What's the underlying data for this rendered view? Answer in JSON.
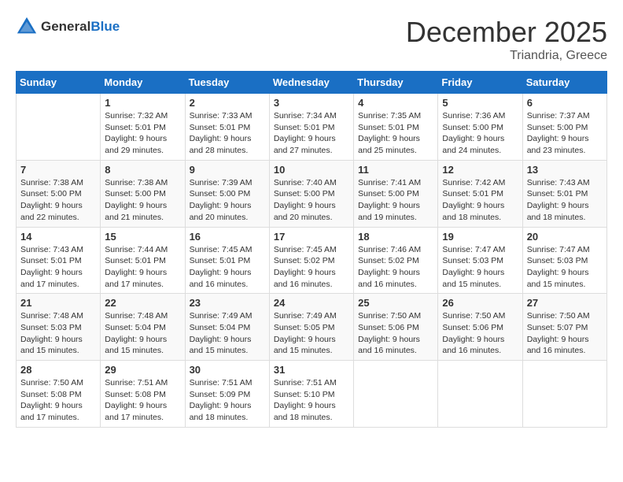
{
  "header": {
    "logo_general": "General",
    "logo_blue": "Blue",
    "month_title": "December 2025",
    "location": "Triandria, Greece"
  },
  "days_of_week": [
    "Sunday",
    "Monday",
    "Tuesday",
    "Wednesday",
    "Thursday",
    "Friday",
    "Saturday"
  ],
  "weeks": [
    [
      {
        "num": "",
        "sunrise": "",
        "sunset": "",
        "daylight": ""
      },
      {
        "num": "1",
        "sunrise": "Sunrise: 7:32 AM",
        "sunset": "Sunset: 5:01 PM",
        "daylight": "Daylight: 9 hours and 29 minutes."
      },
      {
        "num": "2",
        "sunrise": "Sunrise: 7:33 AM",
        "sunset": "Sunset: 5:01 PM",
        "daylight": "Daylight: 9 hours and 28 minutes."
      },
      {
        "num": "3",
        "sunrise": "Sunrise: 7:34 AM",
        "sunset": "Sunset: 5:01 PM",
        "daylight": "Daylight: 9 hours and 27 minutes."
      },
      {
        "num": "4",
        "sunrise": "Sunrise: 7:35 AM",
        "sunset": "Sunset: 5:01 PM",
        "daylight": "Daylight: 9 hours and 25 minutes."
      },
      {
        "num": "5",
        "sunrise": "Sunrise: 7:36 AM",
        "sunset": "Sunset: 5:00 PM",
        "daylight": "Daylight: 9 hours and 24 minutes."
      },
      {
        "num": "6",
        "sunrise": "Sunrise: 7:37 AM",
        "sunset": "Sunset: 5:00 PM",
        "daylight": "Daylight: 9 hours and 23 minutes."
      }
    ],
    [
      {
        "num": "7",
        "sunrise": "Sunrise: 7:38 AM",
        "sunset": "Sunset: 5:00 PM",
        "daylight": "Daylight: 9 hours and 22 minutes."
      },
      {
        "num": "8",
        "sunrise": "Sunrise: 7:38 AM",
        "sunset": "Sunset: 5:00 PM",
        "daylight": "Daylight: 9 hours and 21 minutes."
      },
      {
        "num": "9",
        "sunrise": "Sunrise: 7:39 AM",
        "sunset": "Sunset: 5:00 PM",
        "daylight": "Daylight: 9 hours and 20 minutes."
      },
      {
        "num": "10",
        "sunrise": "Sunrise: 7:40 AM",
        "sunset": "Sunset: 5:00 PM",
        "daylight": "Daylight: 9 hours and 20 minutes."
      },
      {
        "num": "11",
        "sunrise": "Sunrise: 7:41 AM",
        "sunset": "Sunset: 5:00 PM",
        "daylight": "Daylight: 9 hours and 19 minutes."
      },
      {
        "num": "12",
        "sunrise": "Sunrise: 7:42 AM",
        "sunset": "Sunset: 5:01 PM",
        "daylight": "Daylight: 9 hours and 18 minutes."
      },
      {
        "num": "13",
        "sunrise": "Sunrise: 7:43 AM",
        "sunset": "Sunset: 5:01 PM",
        "daylight": "Daylight: 9 hours and 18 minutes."
      }
    ],
    [
      {
        "num": "14",
        "sunrise": "Sunrise: 7:43 AM",
        "sunset": "Sunset: 5:01 PM",
        "daylight": "Daylight: 9 hours and 17 minutes."
      },
      {
        "num": "15",
        "sunrise": "Sunrise: 7:44 AM",
        "sunset": "Sunset: 5:01 PM",
        "daylight": "Daylight: 9 hours and 17 minutes."
      },
      {
        "num": "16",
        "sunrise": "Sunrise: 7:45 AM",
        "sunset": "Sunset: 5:01 PM",
        "daylight": "Daylight: 9 hours and 16 minutes."
      },
      {
        "num": "17",
        "sunrise": "Sunrise: 7:45 AM",
        "sunset": "Sunset: 5:02 PM",
        "daylight": "Daylight: 9 hours and 16 minutes."
      },
      {
        "num": "18",
        "sunrise": "Sunrise: 7:46 AM",
        "sunset": "Sunset: 5:02 PM",
        "daylight": "Daylight: 9 hours and 16 minutes."
      },
      {
        "num": "19",
        "sunrise": "Sunrise: 7:47 AM",
        "sunset": "Sunset: 5:03 PM",
        "daylight": "Daylight: 9 hours and 15 minutes."
      },
      {
        "num": "20",
        "sunrise": "Sunrise: 7:47 AM",
        "sunset": "Sunset: 5:03 PM",
        "daylight": "Daylight: 9 hours and 15 minutes."
      }
    ],
    [
      {
        "num": "21",
        "sunrise": "Sunrise: 7:48 AM",
        "sunset": "Sunset: 5:03 PM",
        "daylight": "Daylight: 9 hours and 15 minutes."
      },
      {
        "num": "22",
        "sunrise": "Sunrise: 7:48 AM",
        "sunset": "Sunset: 5:04 PM",
        "daylight": "Daylight: 9 hours and 15 minutes."
      },
      {
        "num": "23",
        "sunrise": "Sunrise: 7:49 AM",
        "sunset": "Sunset: 5:04 PM",
        "daylight": "Daylight: 9 hours and 15 minutes."
      },
      {
        "num": "24",
        "sunrise": "Sunrise: 7:49 AM",
        "sunset": "Sunset: 5:05 PM",
        "daylight": "Daylight: 9 hours and 15 minutes."
      },
      {
        "num": "25",
        "sunrise": "Sunrise: 7:50 AM",
        "sunset": "Sunset: 5:06 PM",
        "daylight": "Daylight: 9 hours and 16 minutes."
      },
      {
        "num": "26",
        "sunrise": "Sunrise: 7:50 AM",
        "sunset": "Sunset: 5:06 PM",
        "daylight": "Daylight: 9 hours and 16 minutes."
      },
      {
        "num": "27",
        "sunrise": "Sunrise: 7:50 AM",
        "sunset": "Sunset: 5:07 PM",
        "daylight": "Daylight: 9 hours and 16 minutes."
      }
    ],
    [
      {
        "num": "28",
        "sunrise": "Sunrise: 7:50 AM",
        "sunset": "Sunset: 5:08 PM",
        "daylight": "Daylight: 9 hours and 17 minutes."
      },
      {
        "num": "29",
        "sunrise": "Sunrise: 7:51 AM",
        "sunset": "Sunset: 5:08 PM",
        "daylight": "Daylight: 9 hours and 17 minutes."
      },
      {
        "num": "30",
        "sunrise": "Sunrise: 7:51 AM",
        "sunset": "Sunset: 5:09 PM",
        "daylight": "Daylight: 9 hours and 18 minutes."
      },
      {
        "num": "31",
        "sunrise": "Sunrise: 7:51 AM",
        "sunset": "Sunset: 5:10 PM",
        "daylight": "Daylight: 9 hours and 18 minutes."
      },
      {
        "num": "",
        "sunrise": "",
        "sunset": "",
        "daylight": ""
      },
      {
        "num": "",
        "sunrise": "",
        "sunset": "",
        "daylight": ""
      },
      {
        "num": "",
        "sunrise": "",
        "sunset": "",
        "daylight": ""
      }
    ]
  ]
}
